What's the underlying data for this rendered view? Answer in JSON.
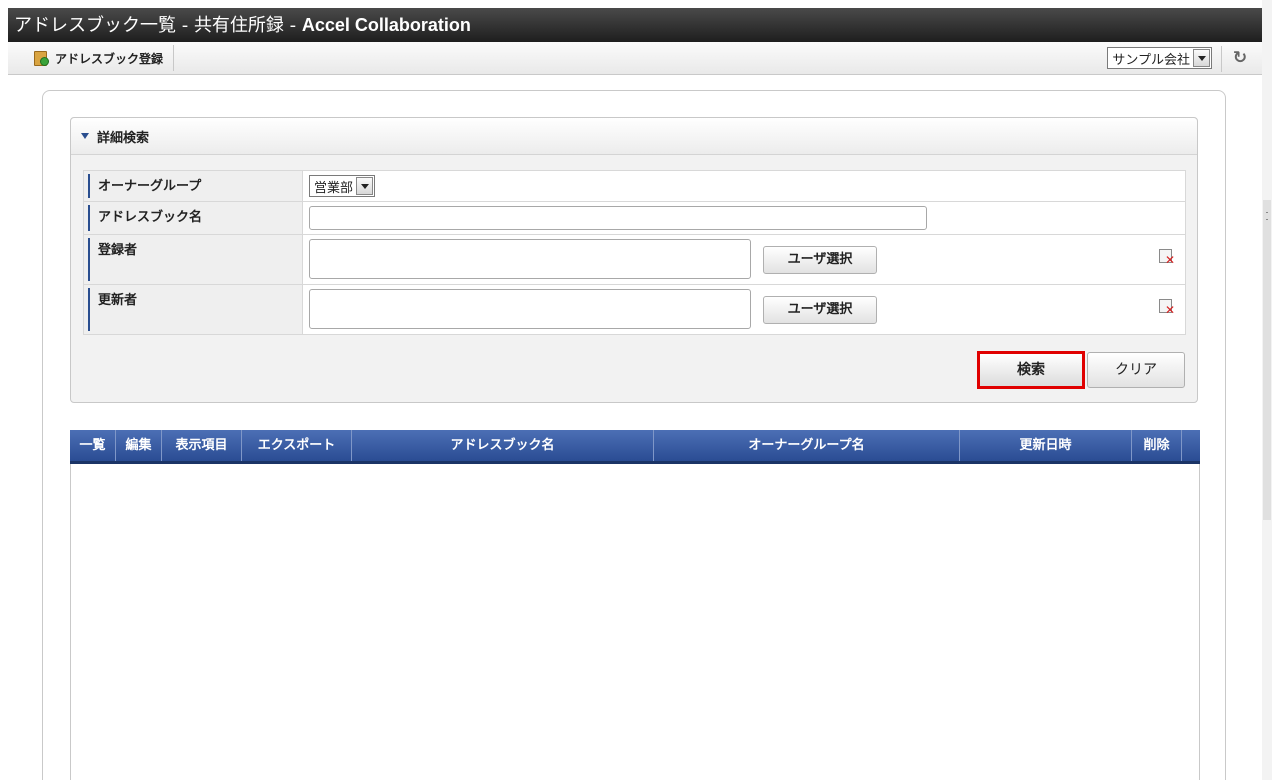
{
  "window": {
    "title_prefix": "アドレスブック一覧 - 共有住所録 - ",
    "app_name": "Accel Collaboration"
  },
  "toolbar": {
    "register_label": "アドレスブック登録",
    "company_select": "サンプル会社",
    "refresh_icon": "refresh-icon"
  },
  "search": {
    "header_label": "詳細検索",
    "fields": {
      "owner_group": {
        "label": "オーナーグループ",
        "value": "営業部"
      },
      "addressbook_name": {
        "label": "アドレスブック名",
        "value": "",
        "placeholder": ""
      },
      "registrant": {
        "label": "登録者",
        "value": "",
        "button": "ユーザ選択"
      },
      "updater": {
        "label": "更新者",
        "value": "",
        "button": "ユーザ選択"
      }
    },
    "search_button": "検索",
    "clear_button": "クリア"
  },
  "grid": {
    "columns": [
      "一覧",
      "編集",
      "表示項目",
      "エクスポート",
      "アドレスブック名",
      "オーナーグループ名",
      "更新日時",
      "削除"
    ],
    "rows": []
  },
  "colors": {
    "accent": "#2a4c93",
    "highlight": "#e00000"
  }
}
